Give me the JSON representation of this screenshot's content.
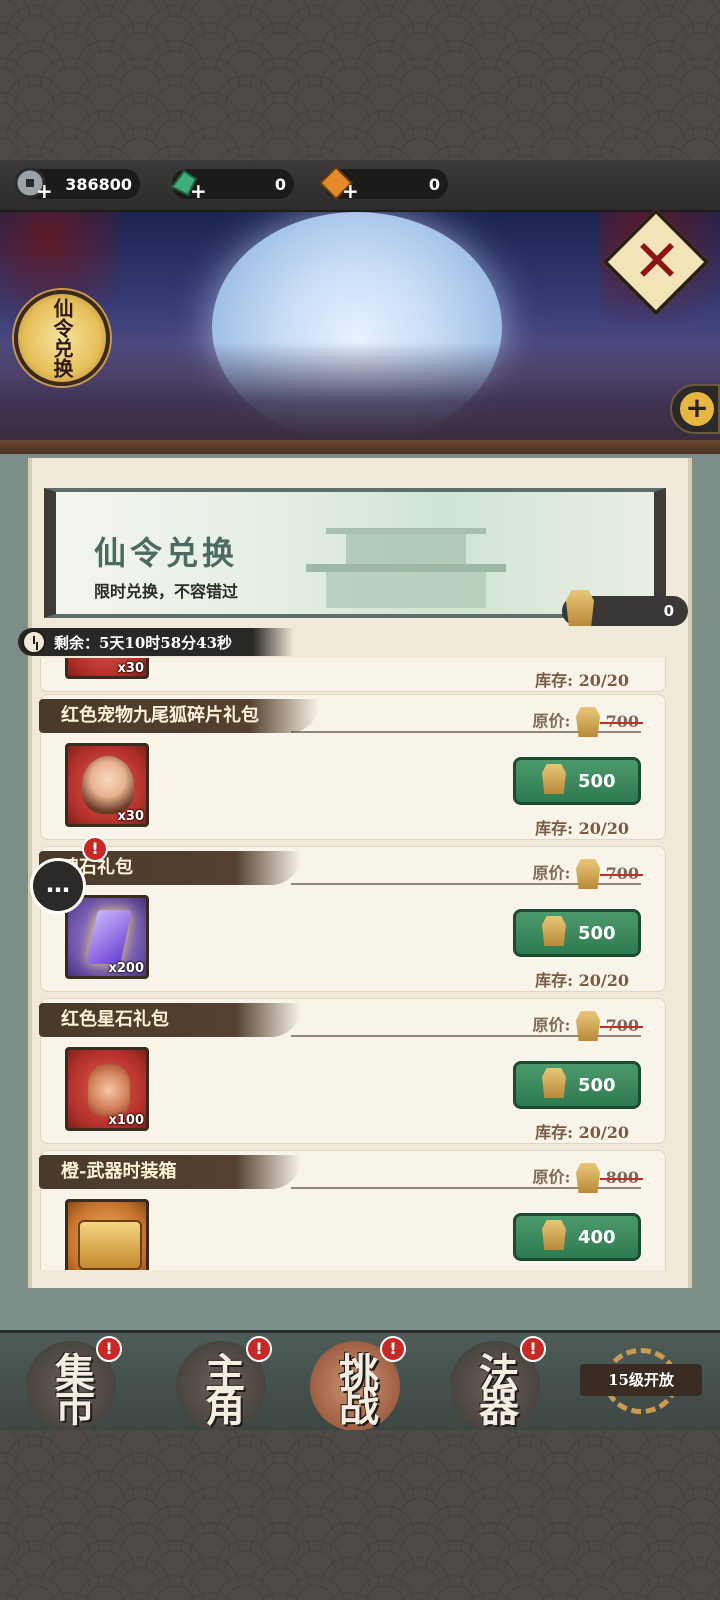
{
  "currency": [
    {
      "icon": "coin-icon",
      "value": "386800"
    },
    {
      "icon": "jade-icon",
      "value": "0"
    },
    {
      "icon": "ticket-icon",
      "value": "0"
    }
  ],
  "emblem_label": "仙令兑换",
  "banner": {
    "title": "仙令兑换",
    "subtitle": "限时兑换，不容错过",
    "token_count": "0"
  },
  "timer": "剩余：5天10时58分43秒",
  "items": [
    {
      "title": "",
      "qty": "x30",
      "orig_label": "",
      "orig_price": "",
      "price": "",
      "stock": "库存: 20/20"
    },
    {
      "title": "红色宠物九尾狐碎片礼包",
      "qty": "x30",
      "orig_label": "原价:",
      "orig_price": "700",
      "price": "500",
      "stock": "库存: 20/20"
    },
    {
      "title": "魂石礼包",
      "qty": "x200",
      "orig_label": "原价:",
      "orig_price": "700",
      "price": "500",
      "stock": "库存: 20/20"
    },
    {
      "title": "红色星石礼包",
      "qty": "x100",
      "orig_label": "原价:",
      "orig_price": "700",
      "price": "500",
      "stock": "库存: 20/20"
    },
    {
      "title": "橙-武器时装箱",
      "qty": "",
      "orig_label": "原价:",
      "orig_price": "800",
      "price": "400",
      "stock": ""
    }
  ],
  "nav": [
    {
      "label": "集市"
    },
    {
      "label": "主角"
    },
    {
      "label": "挑战"
    },
    {
      "label": "法器"
    }
  ],
  "locked_label": "15级开放",
  "alert_mark": "!",
  "chat_glyph": "…",
  "close_glyph": "✕",
  "plus_glyph": "+",
  "colors": {
    "accent_green": "#2e7a51",
    "alert_red": "#c72a26",
    "panel_bg": "#f1ead9"
  }
}
